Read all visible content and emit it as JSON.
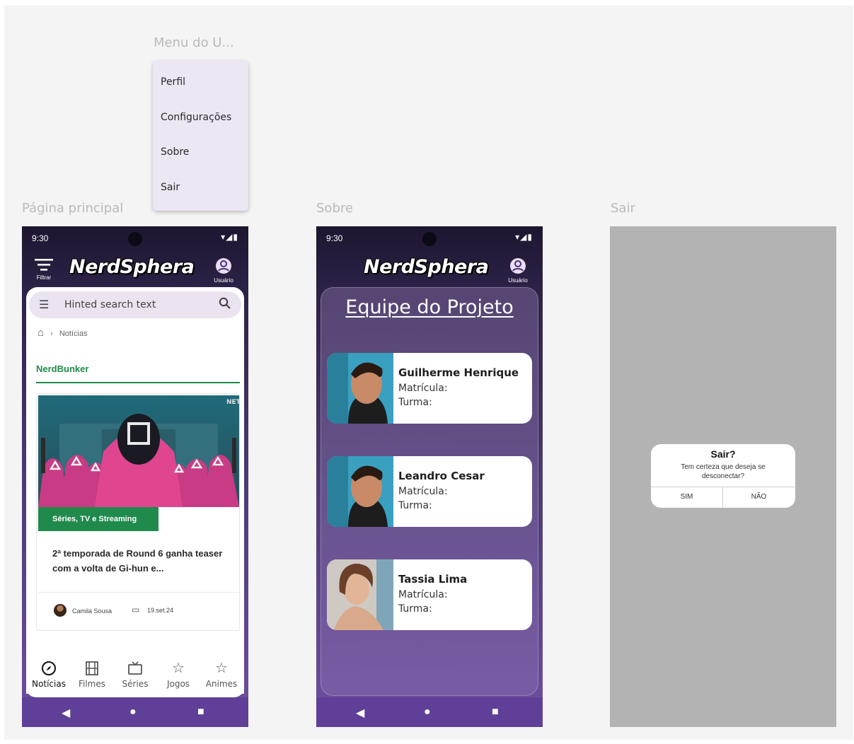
{
  "labels": {
    "user_menu": "Menu do U...",
    "main": "Página principal",
    "sobre": "Sobre",
    "sair": "Sair"
  },
  "user_menu": {
    "items": [
      "Perfil",
      "Configurações",
      "Sobre",
      "Sair"
    ]
  },
  "status": {
    "time": "9:30",
    "icons": "▾◢▮"
  },
  "app": {
    "logo": "NerdSphera",
    "filter_label": "Filtrar",
    "user_label": "Usuário"
  },
  "main": {
    "search_placeholder": "Hinted search text",
    "breadcrumb": "Notícias",
    "section": "NerdBunker",
    "article": {
      "tag": "Séries, TV e Streaming",
      "headline": "2ª temporada de Round 6 ganha teaser com a volta de Gi-hun e...",
      "author": "Camila Sousa",
      "date": "19.set.24",
      "image_badge": "NET"
    },
    "bottom_nav": [
      {
        "label": "Notícias",
        "icon": "compass-icon"
      },
      {
        "label": "Filmes",
        "icon": "film-icon"
      },
      {
        "label": "Séries",
        "icon": "tv-icon"
      },
      {
        "label": "Jogos",
        "icon": "star-icon"
      },
      {
        "label": "Animes",
        "icon": "star-icon"
      }
    ]
  },
  "sobre": {
    "title": "Equipe do Projeto",
    "members": [
      {
        "name": "Guilherme Henrique",
        "matricula": "Matrícula:",
        "turma": "Turma:"
      },
      {
        "name": "Leandro Cesar",
        "matricula": "Matrícula:",
        "turma": "Turma:"
      },
      {
        "name": "Tassia Lima",
        "matricula": "Matrícula:",
        "turma": "Turma:"
      }
    ]
  },
  "sair": {
    "title": "Sair?",
    "message": "Tem certeza que deseja se desconectar?",
    "yes": "SIM",
    "no": "NÃO"
  },
  "colors": {
    "accent": "#1f8a4c",
    "nav": "#5f3f97",
    "menu_bg": "#ede6f3"
  }
}
